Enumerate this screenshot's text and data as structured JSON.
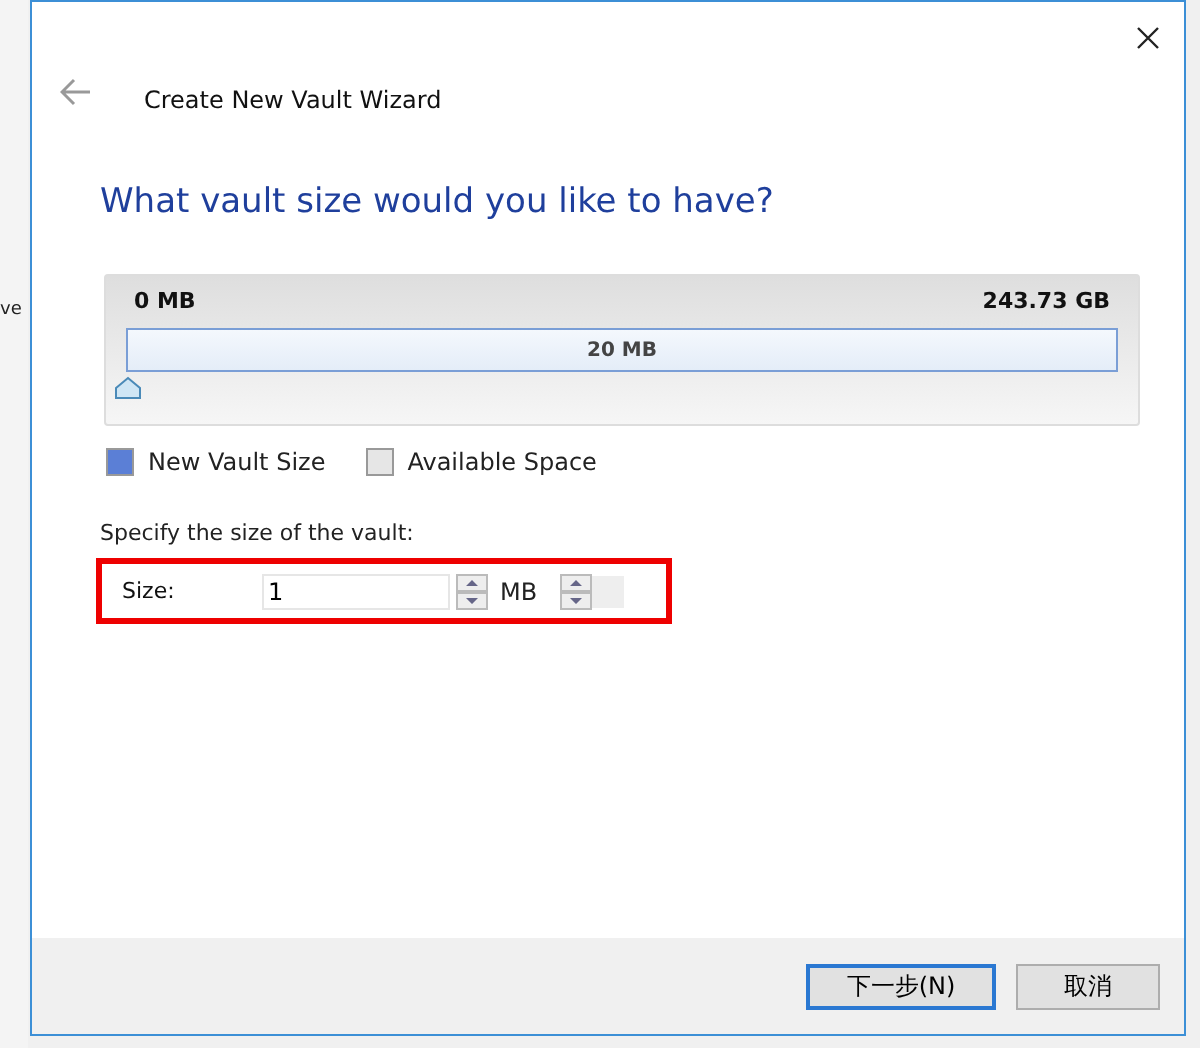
{
  "background_window": {
    "text": "ve"
  },
  "window": {
    "title": "Create New Vault Wizard"
  },
  "heading": "What vault size would you like to have?",
  "size_chart": {
    "min_label": "0 MB",
    "max_label": "243.73 GB",
    "bar_label": "20 MB",
    "level": 0
  },
  "legend": [
    {
      "label": "New Vault Size",
      "color": "#5b7fd6"
    },
    {
      "label": "Available Space",
      "color": "#e6e6e6"
    }
  ],
  "size_section": {
    "prompt": "Specify the size of the vault:",
    "label": "Size:",
    "value": "1",
    "unit": "MB",
    "highlighted": true
  },
  "buttons": [
    {
      "label": "下一步(N)",
      "default": true
    },
    {
      "label": "取消",
      "default": false
    }
  ]
}
